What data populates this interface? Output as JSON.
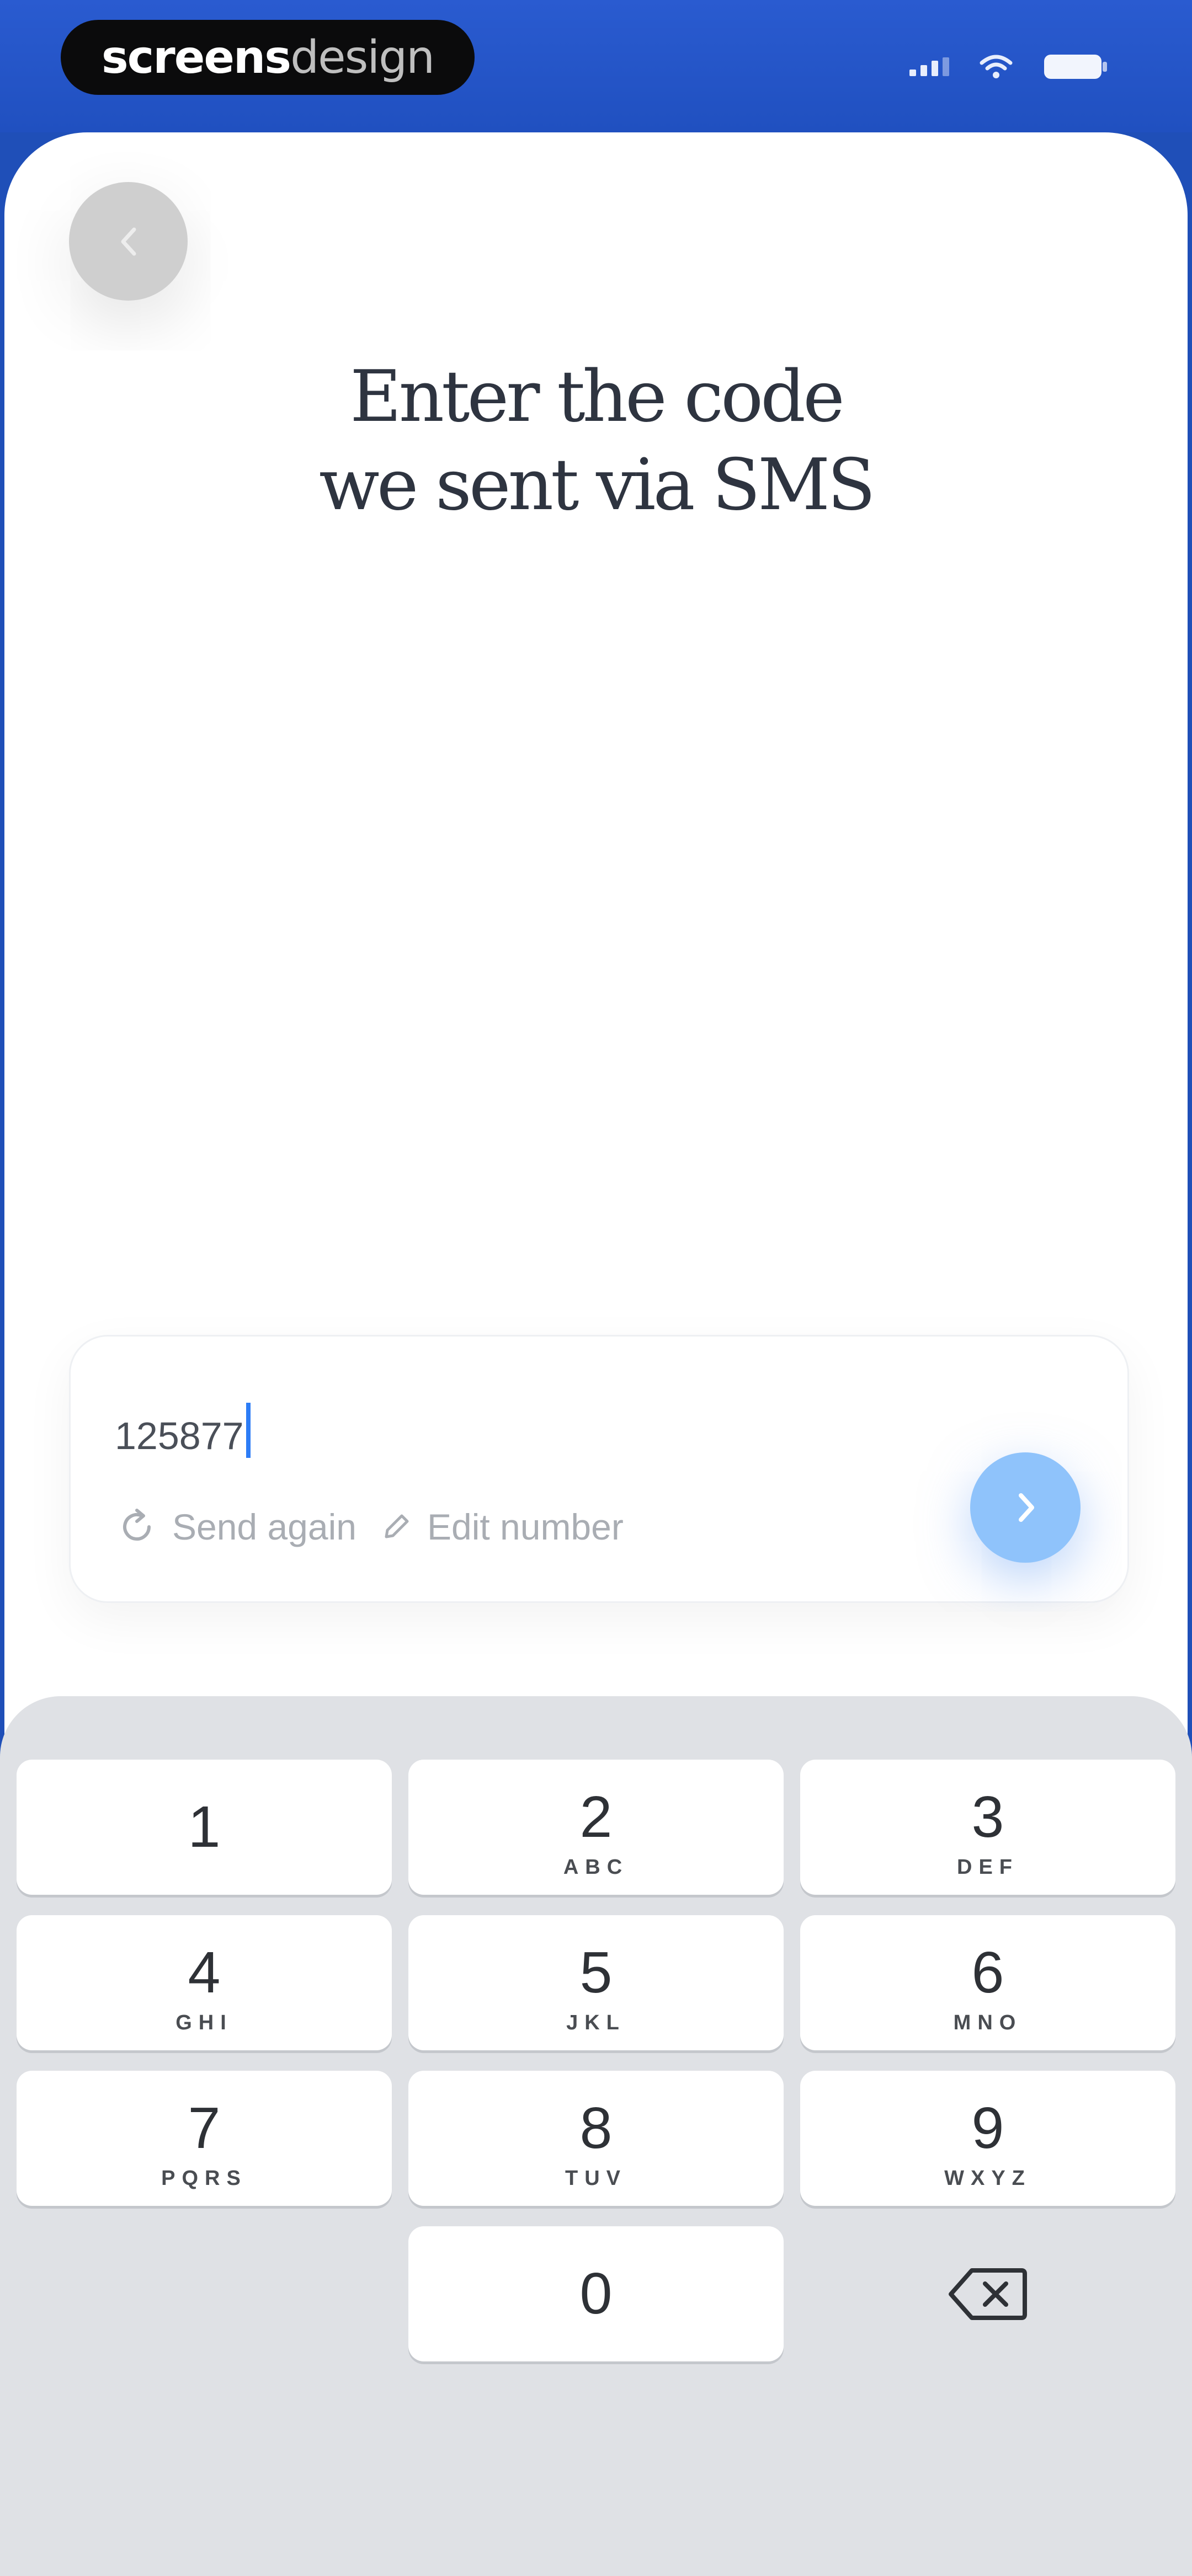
{
  "status_bar": {
    "brand_primary": "screens",
    "brand_secondary": "design",
    "icons": [
      "signal-icon",
      "wifi-icon",
      "battery-icon"
    ]
  },
  "back_icon": "chevron-left-icon",
  "title": {
    "line1": "Enter the code",
    "line2": "we sent via SMS"
  },
  "code_form": {
    "value": "125877",
    "send_again_label": "Send again",
    "send_again_icon": "refresh-icon",
    "edit_number_label": "Edit number",
    "edit_number_icon": "pencil-icon",
    "submit_icon": "chevron-right-icon"
  },
  "keypad": {
    "keys": [
      {
        "digit": "1",
        "letters": ""
      },
      {
        "digit": "2",
        "letters": "ABC"
      },
      {
        "digit": "3",
        "letters": "DEF"
      },
      {
        "digit": "4",
        "letters": "GHI"
      },
      {
        "digit": "5",
        "letters": "JKL"
      },
      {
        "digit": "6",
        "letters": "MNO"
      },
      {
        "digit": "7",
        "letters": "PQRS"
      },
      {
        "digit": "8",
        "letters": "TUV"
      },
      {
        "digit": "9",
        "letters": "WXYZ"
      },
      {
        "digit": "0",
        "letters": ""
      }
    ],
    "delete_icon": "backspace-icon"
  },
  "colors": {
    "status_bar_bg": "#2250c4",
    "accent": "#8fc3fb",
    "caret": "#2d7df6",
    "keyboard_bg": "#dfe1e5"
  }
}
